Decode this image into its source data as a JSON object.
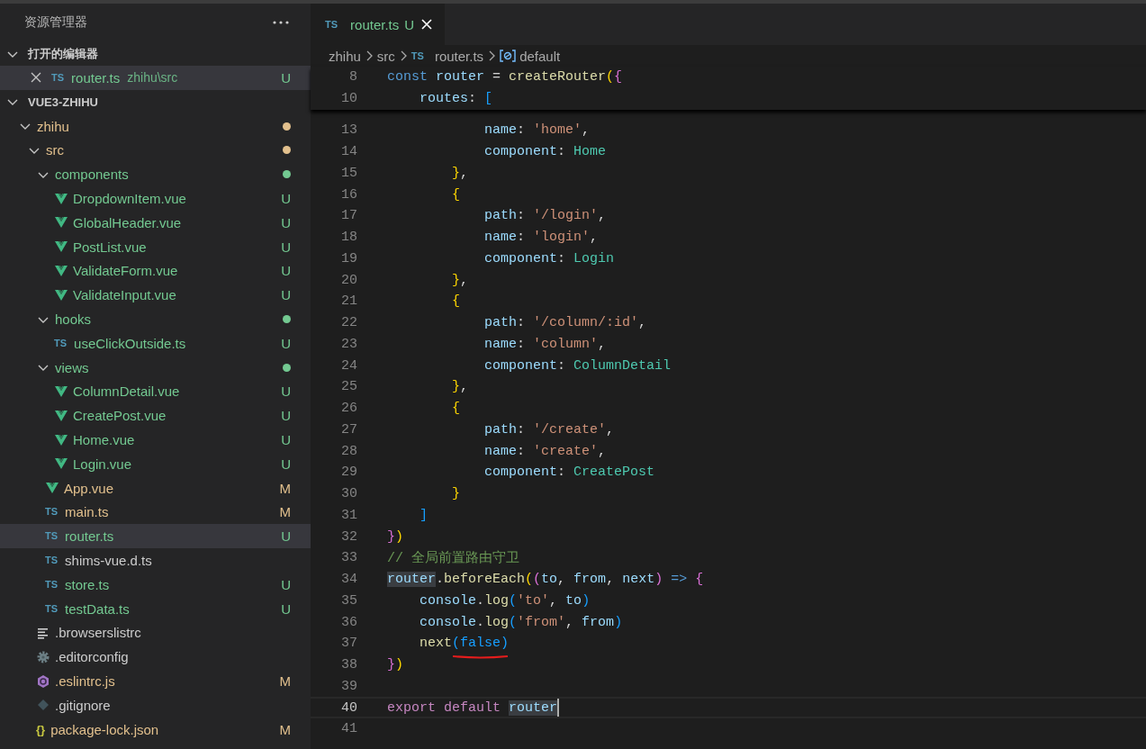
{
  "sidebar": {
    "title": "资源管理器",
    "open_editors": {
      "title": "打开的编辑器",
      "expanded": true,
      "items": [
        {
          "kind": "ts",
          "icon_text": "TS",
          "name": "router.ts",
          "path": "zhihu\\src",
          "color": "#73c991",
          "status": "U",
          "selected": true
        }
      ]
    },
    "workspace": {
      "title": "VUE3-ZHIHU",
      "expanded": true,
      "items": [
        {
          "kind": "folder",
          "name": "zhihu",
          "color": "#e2c08d",
          "expanded": true,
          "selected": false,
          "children": [
            {
              "kind": "folder",
              "name": "src",
              "color": "#e2c08d",
              "expanded": true,
              "selected": false,
              "children": [
                {
                  "kind": "folder",
                  "name": "components",
                  "color": "#73c991",
                  "expanded": true,
                  "selected": false,
                  "children": [
                    {
                      "kind": "vue",
                      "name": "DropdownItem.vue",
                      "color": "#73c991",
                      "status": "U",
                      "selected": false
                    },
                    {
                      "kind": "vue",
                      "name": "GlobalHeader.vue",
                      "color": "#73c991",
                      "status": "U",
                      "selected": false
                    },
                    {
                      "kind": "vue",
                      "name": "PostList.vue",
                      "color": "#73c991",
                      "status": "U",
                      "selected": false
                    },
                    {
                      "kind": "vue",
                      "name": "ValidateForm.vue",
                      "color": "#73c991",
                      "status": "U",
                      "selected": false
                    },
                    {
                      "kind": "vue",
                      "name": "ValidateInput.vue",
                      "color": "#73c991",
                      "status": "U",
                      "selected": false
                    }
                  ]
                },
                {
                  "kind": "folder",
                  "name": "hooks",
                  "color": "#73c991",
                  "expanded": true,
                  "selected": false,
                  "children": [
                    {
                      "kind": "ts",
                      "icon_text": "TS",
                      "name": "useClickOutside.ts",
                      "color": "#73c991",
                      "status": "U",
                      "selected": false
                    }
                  ]
                },
                {
                  "kind": "folder",
                  "name": "views",
                  "color": "#73c991",
                  "expanded": true,
                  "selected": false,
                  "children": [
                    {
                      "kind": "vue",
                      "name": "ColumnDetail.vue",
                      "color": "#73c991",
                      "status": "U",
                      "selected": false
                    },
                    {
                      "kind": "vue",
                      "name": "CreatePost.vue",
                      "color": "#73c991",
                      "status": "U",
                      "selected": false
                    },
                    {
                      "kind": "vue",
                      "name": "Home.vue",
                      "color": "#73c991",
                      "status": "U",
                      "selected": false
                    },
                    {
                      "kind": "vue",
                      "name": "Login.vue",
                      "color": "#73c991",
                      "status": "U",
                      "selected": false
                    }
                  ]
                },
                {
                  "kind": "vue",
                  "name": "App.vue",
                  "color": "#e2c08d",
                  "status": "M",
                  "selected": false
                },
                {
                  "kind": "ts",
                  "icon_text": "TS",
                  "name": "main.ts",
                  "color": "#e2c08d",
                  "status": "M",
                  "selected": false
                },
                {
                  "kind": "ts",
                  "icon_text": "TS",
                  "name": "router.ts",
                  "color": "#73c991",
                  "status": "U",
                  "selected": true
                },
                {
                  "kind": "ts",
                  "icon_text": "TS",
                  "name": "shims-vue.d.ts",
                  "color": "#cccccc",
                  "selected": false
                },
                {
                  "kind": "ts",
                  "icon_text": "TS",
                  "name": "store.ts",
                  "color": "#73c991",
                  "status": "U",
                  "selected": false
                },
                {
                  "kind": "ts",
                  "icon_text": "TS",
                  "name": "testData.ts",
                  "color": "#73c991",
                  "status": "U",
                  "selected": false
                }
              ]
            },
            {
              "kind": "lines",
              "name": ".browserslistrc",
              "color": "#cccccc",
              "selected": false
            },
            {
              "kind": "gear",
              "name": ".editorconfig",
              "color": "#cccccc",
              "selected": false
            },
            {
              "kind": "eslint",
              "name": ".eslintrc.js",
              "color": "#e2c08d",
              "status": "M",
              "selected": false
            },
            {
              "kind": "git",
              "name": ".gitignore",
              "color": "#cccccc",
              "selected": false
            },
            {
              "kind": "json",
              "icon_text": "{}",
              "name": "package-lock.json",
              "color": "#e2c08d",
              "status": "M",
              "selected": false
            }
          ]
        }
      ]
    }
  },
  "tabs": [
    {
      "icon_text": "TS",
      "label": "router.ts",
      "color": "#73c991",
      "status": "U",
      "selected": true
    }
  ],
  "breadcrumb": [
    {
      "label": "zhihu"
    },
    {
      "label": "src"
    },
    {
      "icon_text": "TS",
      "label": "router.ts"
    },
    {
      "kind": "symbol",
      "label": "default"
    }
  ],
  "editor": {
    "sticky_lines": [
      {
        "n": "8",
        "tokens": [
          {
            "kind": "kw",
            "text": "const "
          },
          {
            "kind": "var",
            "text": "router"
          },
          {
            "kind": "p",
            "text": " = "
          },
          {
            "kind": "fn",
            "text": "createRouter"
          },
          {
            "kind": "b1",
            "text": "("
          },
          {
            "kind": "b2",
            "text": "{"
          }
        ]
      },
      {
        "n": "10",
        "tokens": [
          {
            "kind": "var",
            "text": "    routes"
          },
          {
            "kind": "p",
            "text": ": "
          },
          {
            "kind": "b3",
            "text": "["
          }
        ]
      }
    ],
    "lines": [
      {
        "n": "13",
        "current": false,
        "tokens": [
          {
            "kind": "var",
            "text": "            name"
          },
          {
            "kind": "p",
            "text": ": "
          },
          {
            "kind": "str",
            "text": "'home'"
          },
          {
            "kind": "p",
            "text": ","
          }
        ]
      },
      {
        "n": "14",
        "current": false,
        "tokens": [
          {
            "kind": "var",
            "text": "            component"
          },
          {
            "kind": "p",
            "text": ": "
          },
          {
            "kind": "cls",
            "text": "Home"
          }
        ]
      },
      {
        "n": "15",
        "current": false,
        "tokens": [
          {
            "kind": "b1",
            "text": "        }"
          },
          {
            "kind": "p",
            "text": ","
          }
        ]
      },
      {
        "n": "16",
        "current": false,
        "tokens": [
          {
            "kind": "b1",
            "text": "        {"
          }
        ]
      },
      {
        "n": "17",
        "current": false,
        "tokens": [
          {
            "kind": "var",
            "text": "            path"
          },
          {
            "kind": "p",
            "text": ": "
          },
          {
            "kind": "str",
            "text": "'/login'"
          },
          {
            "kind": "p",
            "text": ","
          }
        ]
      },
      {
        "n": "18",
        "current": false,
        "tokens": [
          {
            "kind": "var",
            "text": "            name"
          },
          {
            "kind": "p",
            "text": ": "
          },
          {
            "kind": "str",
            "text": "'login'"
          },
          {
            "kind": "p",
            "text": ","
          }
        ]
      },
      {
        "n": "19",
        "current": false,
        "tokens": [
          {
            "kind": "var",
            "text": "            component"
          },
          {
            "kind": "p",
            "text": ": "
          },
          {
            "kind": "cls",
            "text": "Login"
          }
        ]
      },
      {
        "n": "20",
        "current": false,
        "tokens": [
          {
            "kind": "b1",
            "text": "        }"
          },
          {
            "kind": "p",
            "text": ","
          }
        ]
      },
      {
        "n": "21",
        "current": false,
        "tokens": [
          {
            "kind": "b1",
            "text": "        {"
          }
        ]
      },
      {
        "n": "22",
        "current": false,
        "tokens": [
          {
            "kind": "var",
            "text": "            path"
          },
          {
            "kind": "p",
            "text": ": "
          },
          {
            "kind": "str",
            "text": "'/column/:id'"
          },
          {
            "kind": "p",
            "text": ","
          }
        ]
      },
      {
        "n": "23",
        "current": false,
        "tokens": [
          {
            "kind": "var",
            "text": "            name"
          },
          {
            "kind": "p",
            "text": ": "
          },
          {
            "kind": "str",
            "text": "'column'"
          },
          {
            "kind": "p",
            "text": ","
          }
        ]
      },
      {
        "n": "24",
        "current": false,
        "tokens": [
          {
            "kind": "var",
            "text": "            component"
          },
          {
            "kind": "p",
            "text": ": "
          },
          {
            "kind": "cls",
            "text": "ColumnDetail"
          }
        ]
      },
      {
        "n": "25",
        "current": false,
        "tokens": [
          {
            "kind": "b1",
            "text": "        }"
          },
          {
            "kind": "p",
            "text": ","
          }
        ]
      },
      {
        "n": "26",
        "current": false,
        "tokens": [
          {
            "kind": "b1",
            "text": "        {"
          }
        ]
      },
      {
        "n": "27",
        "current": false,
        "tokens": [
          {
            "kind": "var",
            "text": "            path"
          },
          {
            "kind": "p",
            "text": ": "
          },
          {
            "kind": "str",
            "text": "'/create'"
          },
          {
            "kind": "p",
            "text": ","
          }
        ]
      },
      {
        "n": "28",
        "current": false,
        "tokens": [
          {
            "kind": "var",
            "text": "            name"
          },
          {
            "kind": "p",
            "text": ": "
          },
          {
            "kind": "str",
            "text": "'create'"
          },
          {
            "kind": "p",
            "text": ","
          }
        ]
      },
      {
        "n": "29",
        "current": false,
        "tokens": [
          {
            "kind": "var",
            "text": "            component"
          },
          {
            "kind": "p",
            "text": ": "
          },
          {
            "kind": "cls",
            "text": "CreatePost"
          }
        ]
      },
      {
        "n": "30",
        "current": false,
        "tokens": [
          {
            "kind": "b1",
            "text": "        }"
          }
        ]
      },
      {
        "n": "31",
        "current": false,
        "tokens": [
          {
            "kind": "b3",
            "text": "    ]"
          }
        ]
      },
      {
        "n": "32",
        "current": false,
        "tokens": [
          {
            "kind": "b2",
            "text": "}"
          },
          {
            "kind": "b1",
            "text": ")"
          }
        ]
      },
      {
        "n": "33",
        "current": false,
        "tokens": [
          {
            "kind": "cm",
            "text": "// 全局前置路由守卫"
          }
        ]
      },
      {
        "n": "34",
        "current": false,
        "tokens": [
          {
            "kind": "hl",
            "text": "router"
          },
          {
            "kind": "p",
            "text": "."
          },
          {
            "kind": "fn",
            "text": "beforeEach"
          },
          {
            "kind": "b1",
            "text": "("
          },
          {
            "kind": "b2",
            "text": "("
          },
          {
            "kind": "var",
            "text": "to"
          },
          {
            "kind": "p",
            "text": ", "
          },
          {
            "kind": "var",
            "text": "from"
          },
          {
            "kind": "p",
            "text": ", "
          },
          {
            "kind": "var",
            "text": "next"
          },
          {
            "kind": "b2",
            "text": ") "
          },
          {
            "kind": "kw",
            "text": "=> "
          },
          {
            "kind": "b2",
            "text": "{"
          }
        ]
      },
      {
        "n": "35",
        "current": false,
        "tokens": [
          {
            "kind": "var",
            "text": "    console"
          },
          {
            "kind": "p",
            "text": "."
          },
          {
            "kind": "fn",
            "text": "log"
          },
          {
            "kind": "b3",
            "text": "("
          },
          {
            "kind": "str",
            "text": "'to'"
          },
          {
            "kind": "p",
            "text": ", "
          },
          {
            "kind": "var",
            "text": "to"
          },
          {
            "kind": "b3",
            "text": ")"
          }
        ]
      },
      {
        "n": "36",
        "current": false,
        "tokens": [
          {
            "kind": "var",
            "text": "    console"
          },
          {
            "kind": "p",
            "text": "."
          },
          {
            "kind": "fn",
            "text": "log"
          },
          {
            "kind": "b3",
            "text": "("
          },
          {
            "kind": "str",
            "text": "'from'"
          },
          {
            "kind": "p",
            "text": ", "
          },
          {
            "kind": "var",
            "text": "from"
          },
          {
            "kind": "b3",
            "text": ")"
          }
        ]
      },
      {
        "n": "37",
        "current": false,
        "tokens": [
          {
            "kind": "fn",
            "text": "    next"
          },
          {
            "kind": "b3",
            "text": "(false)",
            "underlined": true
          }
        ]
      },
      {
        "n": "38",
        "current": false,
        "tokens": [
          {
            "kind": "b2",
            "text": "}"
          },
          {
            "kind": "b1",
            "text": ")"
          }
        ]
      },
      {
        "n": "39",
        "current": false
      },
      {
        "n": "40",
        "current": true,
        "tokens": [
          {
            "kind": "kw2",
            "text": "export "
          },
          {
            "kind": "kw2",
            "text": "default "
          },
          {
            "kind": "hl",
            "text": "router"
          }
        ]
      },
      {
        "n": "41",
        "current": false
      }
    ]
  }
}
